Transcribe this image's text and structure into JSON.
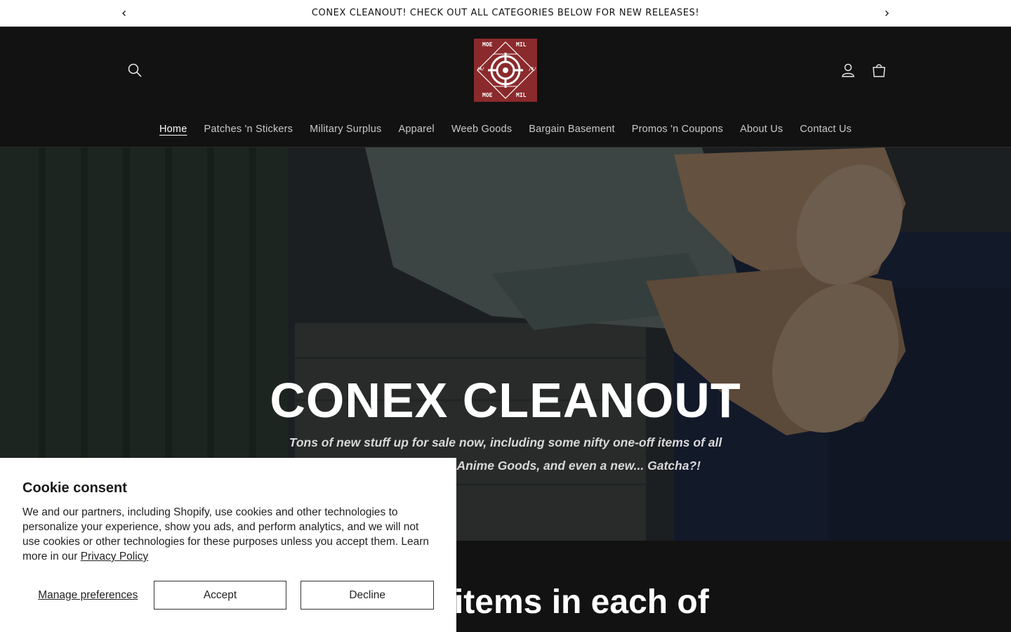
{
  "announcement": {
    "text": "CONEX CLEANOUT! CHECK OUT ALL CATEGORIES BELOW FOR NEW RELEASES!"
  },
  "header": {
    "logo_text": {
      "top_left": "MOE",
      "top_right": "MIL",
      "bottom_left": "MOE",
      "bottom_right": "MIL",
      "left": "/A/",
      "right": "/K/"
    }
  },
  "nav": {
    "items": [
      {
        "label": "Home",
        "active": true
      },
      {
        "label": "Patches 'n Stickers"
      },
      {
        "label": "Military Surplus"
      },
      {
        "label": "Apparel"
      },
      {
        "label": "Weeb Goods"
      },
      {
        "label": "Bargain Basement"
      },
      {
        "label": "Promos 'n Coupons"
      },
      {
        "label": "About Us"
      },
      {
        "label": "Contact Us"
      }
    ]
  },
  "hero": {
    "title": "CONEX CLEANOUT",
    "subtitle": "Tons of new stuff up for sale now, including some nifty one-off items of all sorts in Military Surplus, Anime Goods, and even a new... Gatcha?!"
  },
  "section": {
    "heading": "...new items in each of"
  },
  "cookie": {
    "title": "Cookie consent",
    "body": "We and our partners, including Shopify, use cookies and other technologies to personalize your experience, show you ads, and perform analytics, and we will not use cookies or other technologies for these purposes unless you accept them. Learn more in our ",
    "link": "Privacy Policy",
    "manage": "Manage preferences",
    "accept": "Accept",
    "decline": "Decline"
  },
  "colors": {
    "header_bg": "#121212",
    "logo_bg": "#8b2a2c",
    "announcement_bg": "#ffffff"
  }
}
